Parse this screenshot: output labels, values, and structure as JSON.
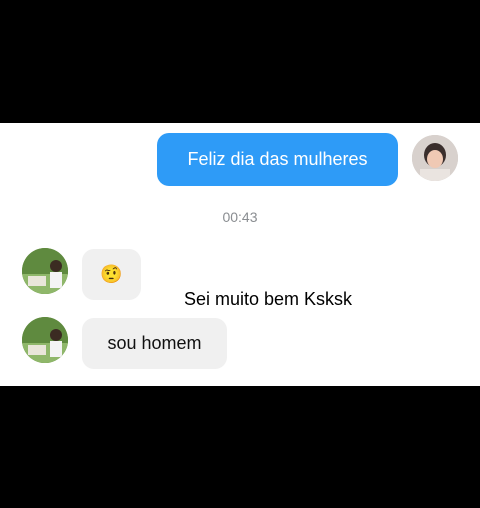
{
  "messages": {
    "outgoing_1": "Feliz dia das mulheres",
    "timestamp": "00:43",
    "incoming_emoji": "🤨",
    "incoming_text": "sou homem"
  },
  "overlay": {
    "caption": "Sei muito bem Ksksk"
  },
  "colors": {
    "outgoing_bubble": "#2e9bf7",
    "incoming_bubble": "#f0f0f0",
    "letterbox": "#000000"
  },
  "icons": {
    "my_avatar": "user-avatar-photo",
    "their_avatar": "contact-avatar-photo"
  }
}
